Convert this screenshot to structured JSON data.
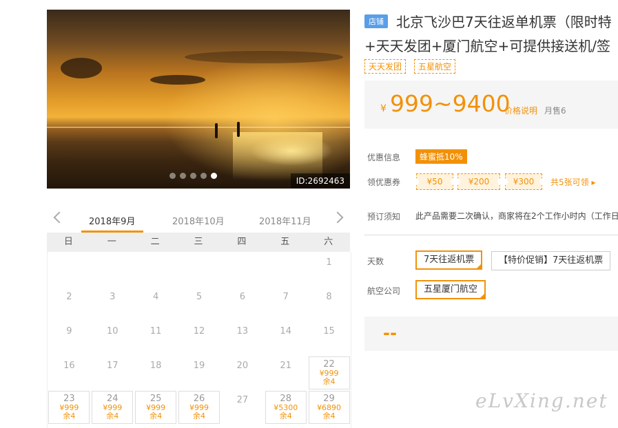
{
  "gallery": {
    "photo_id": "ID:2692463",
    "slide_count": 5,
    "active_slide": 5
  },
  "calendar": {
    "tabs": [
      "2018年9月",
      "2018年10月",
      "2018年11月"
    ],
    "active_tab": 0,
    "weekdays": [
      "日",
      "一",
      "二",
      "三",
      "四",
      "五",
      "六"
    ],
    "days": [
      {
        "day": "1"
      },
      {
        "day": "2"
      },
      {
        "day": "3"
      },
      {
        "day": "4"
      },
      {
        "day": "5"
      },
      {
        "day": "6"
      },
      {
        "day": "7"
      },
      {
        "day": "8"
      },
      {
        "day": "9"
      },
      {
        "day": "10"
      },
      {
        "day": "11"
      },
      {
        "day": "12"
      },
      {
        "day": "13"
      },
      {
        "day": "14"
      },
      {
        "day": "15"
      },
      {
        "day": "16"
      },
      {
        "day": "17"
      },
      {
        "day": "18"
      },
      {
        "day": "19"
      },
      {
        "day": "20"
      },
      {
        "day": "21"
      },
      {
        "day": "22",
        "price": "¥999",
        "remain": "余4"
      },
      {
        "day": "23",
        "price": "¥999",
        "remain": "余4"
      },
      {
        "day": "24",
        "price": "¥999",
        "remain": "余4"
      },
      {
        "day": "25",
        "price": "¥999",
        "remain": "余4"
      },
      {
        "day": "26",
        "price": "¥999",
        "remain": "余4"
      },
      {
        "day": "27"
      },
      {
        "day": "28",
        "price": "¥5300",
        "remain": "余4"
      },
      {
        "day": "29",
        "price": "¥6890",
        "remain": "余4"
      }
    ],
    "first_weekday": 6
  },
  "product": {
    "shop_badge": "店铺",
    "title_line1": "北京飞沙巴7天往返单机票（限时特",
    "title_line2": "+天天发团+厦门航空+可提供接送机/签",
    "tags": [
      "天天发团",
      "五星航空"
    ],
    "currency": "¥",
    "price_range": "999~9400",
    "price_note": "价格说明",
    "monthly_sales": "月售6",
    "promo_label": "优惠信息",
    "promo_badge": "蜂蜜抵10%",
    "coupon_label": "领优惠券",
    "coupons": [
      "¥50",
      "¥200",
      "¥300"
    ],
    "coupon_more": "共5张可领 ▸",
    "notice_label": "预订须知",
    "notice_text": "此产品需要二次确认，商家将在2个工作小时内（工作日",
    "days_label": "天数",
    "days_options": [
      "7天往返机票",
      "【特价促销】7天往返机票"
    ],
    "airline_label": "航空公司",
    "airline_options": [
      "五星厦门航空"
    ],
    "bottom_text": "--"
  },
  "watermark": "eLvXing.net",
  "colors": {
    "accent": "#f29107",
    "shop_badge": "#5a9ee8"
  }
}
